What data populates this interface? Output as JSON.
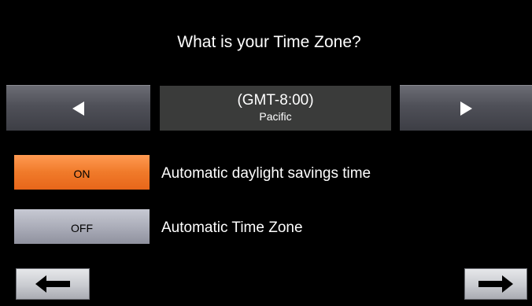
{
  "screen": {
    "title": "What is your Time Zone?"
  },
  "timezone": {
    "code": "(GMT-8:00)",
    "name": "Pacific",
    "prev_icon": "triangle-left-icon",
    "next_icon": "triangle-right-icon"
  },
  "options": [
    {
      "state_label": "ON",
      "label": "Automatic daylight savings time",
      "enabled": true
    },
    {
      "state_label": "OFF",
      "label": "Automatic Time Zone",
      "enabled": false
    }
  ],
  "navigation": {
    "back_icon": "arrow-left-icon",
    "next_icon": "arrow-right-icon"
  },
  "colors": {
    "background": "#000000",
    "toggle_on": "#f07a2a",
    "toggle_off": "#a9abb7",
    "display_bg": "#3a3b3a"
  }
}
